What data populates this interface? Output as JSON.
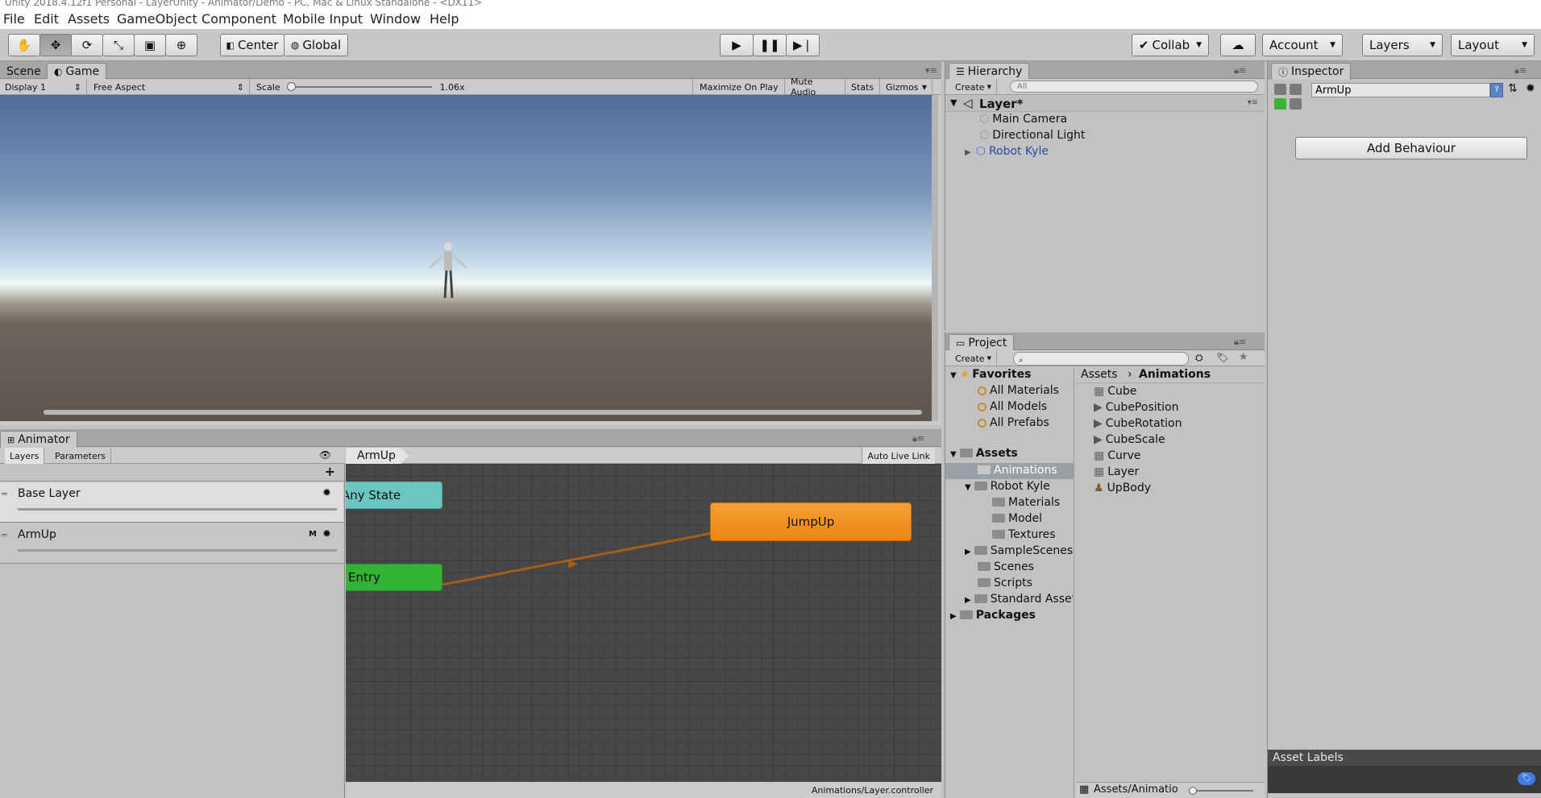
{
  "menu": {
    "title_fragment": "Unity 2018.4.12f1 Personal - LayerUnity - Animator/Demo - PC, Mac & Linux Standalone - <DX11>",
    "items": [
      "File",
      "Edit",
      "Assets",
      "GameObject",
      "Component",
      "Mobile Input",
      "Window",
      "Help"
    ]
  },
  "toolbar": {
    "center": "Center",
    "global": "Global",
    "collab": "Collab",
    "account": "Account",
    "layers": "Layers",
    "layout": "Layout"
  },
  "scene_game": {
    "tabs": [
      "Scene",
      "Game"
    ],
    "display": "Display 1",
    "aspect": "Free Aspect",
    "scale_label": "Scale",
    "scale_value": "1.06x",
    "buttons": [
      "Maximize On Play",
      "Mute Audio",
      "Stats",
      "Gizmos"
    ]
  },
  "animator": {
    "tab": "Animator",
    "subtabs": [
      "Layers",
      "Parameters"
    ],
    "breadcrumb": "ArmUp",
    "auto_live_link": "Auto Live Link",
    "layers": [
      {
        "name": "Base Layer",
        "badge": ""
      },
      {
        "name": "ArmUp",
        "badge": "M"
      }
    ],
    "nodes": {
      "any_state": "Any State",
      "entry": "Entry",
      "jumpup": "JumpUp"
    },
    "footer_path": "Animations/Layer.controller"
  },
  "hierarchy": {
    "tab": "Hierarchy",
    "create": "Create",
    "search_placeholder": "All",
    "scene": "Layer*",
    "items": [
      "Main Camera",
      "Directional Light",
      "Robot Kyle"
    ]
  },
  "project": {
    "tab": "Project",
    "create": "Create",
    "favorites_label": "Favorites",
    "favorites": [
      "All Materials",
      "All Models",
      "All Prefabs"
    ],
    "assets_label": "Assets",
    "folders": [
      {
        "name": "Animations",
        "indent": 1
      },
      {
        "name": "Robot Kyle",
        "indent": 1
      },
      {
        "name": "Materials",
        "indent": 2
      },
      {
        "name": "Model",
        "indent": 2
      },
      {
        "name": "Textures",
        "indent": 2
      },
      {
        "name": "SampleScenes",
        "indent": 1
      },
      {
        "name": "Scenes",
        "indent": 1
      },
      {
        "name": "Scripts",
        "indent": 1
      },
      {
        "name": "Standard Assets",
        "indent": 1
      }
    ],
    "packages_label": "Packages",
    "breadcrumb_root": "Assets",
    "breadcrumb_current": "Animations",
    "files": [
      "Cube",
      "CubePosition",
      "CubeRotation",
      "CubeScale",
      "Curve",
      "Layer",
      "UpBody"
    ],
    "footer_path": "Assets/Animatio"
  },
  "inspector": {
    "tab": "Inspector",
    "name_value": "ArmUp",
    "add_behaviour": "Add Behaviour",
    "asset_labels": "Asset Labels"
  },
  "colors": {
    "any_state": "#6bc6bf",
    "entry": "#33b335",
    "jumpup": "#f08d18",
    "grid": "#474747",
    "transition": "#a15f18"
  }
}
